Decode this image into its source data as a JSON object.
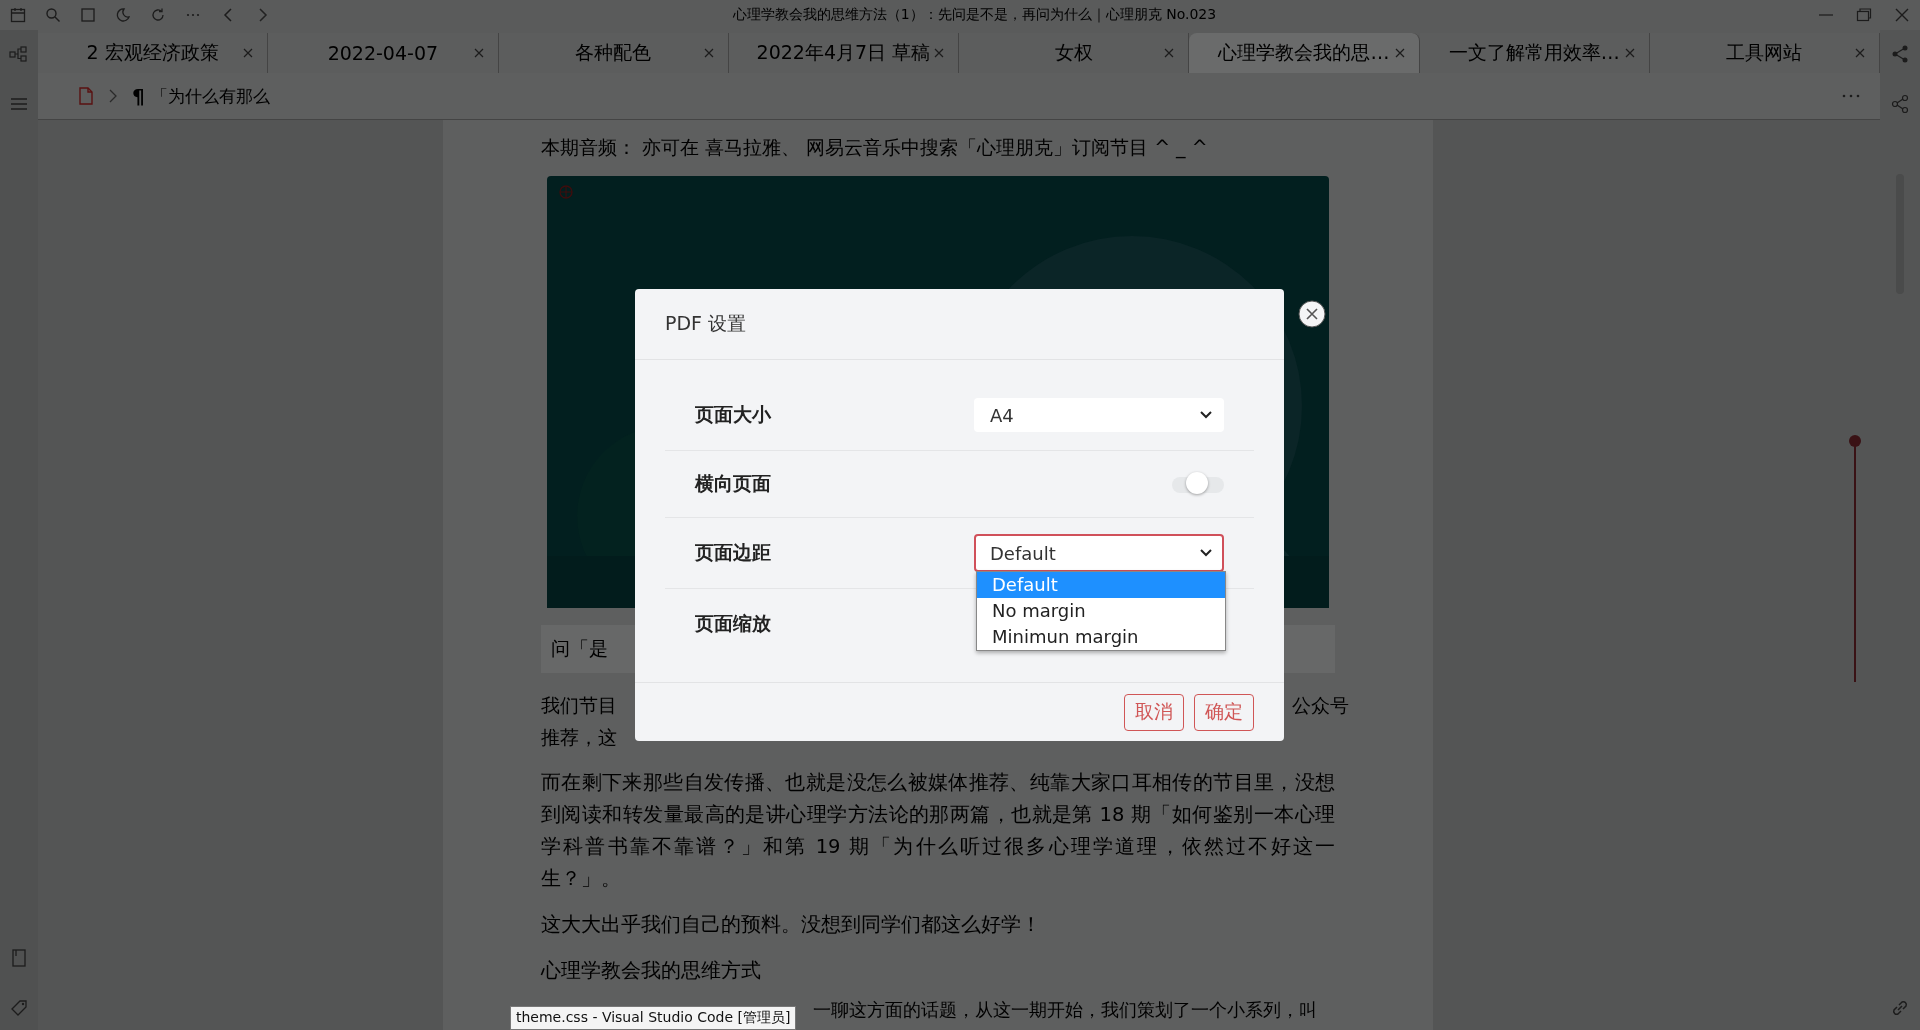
{
  "window": {
    "title": "心理学教会我的思维方法（1）：先问是不是，再问为什么｜心理朋克 No.023"
  },
  "tabs": [
    {
      "label": "2 宏观经济政策",
      "selected": false
    },
    {
      "label": "2022-04-07",
      "selected": false
    },
    {
      "label": "各种配色",
      "selected": false
    },
    {
      "label": "2022年4月7日 草稿",
      "selected": false
    },
    {
      "label": "女权",
      "selected": false
    },
    {
      "label": "心理学教会我的思…",
      "selected": true
    },
    {
      "label": "一文了解常用效率…",
      "selected": false
    },
    {
      "label": "工具网站",
      "selected": false
    }
  ],
  "breadcrumb": {
    "mark": "¶",
    "heading": "「为什么有那么"
  },
  "article": {
    "audio_line": "本期音频： 亦可在 喜马拉雅、 网易云音乐中搜索「心理朋克」订阅节目 ^ _ ^",
    "picture": {
      "kind": "picture"
    },
    "quote": "问「是",
    "p1_left": "我们节目",
    "p1_right": "公众号",
    "p1_line2": "推荐，这",
    "paragraphs": [
      "而在剩下来那些自发传播、也就是没怎么被媒体推荐、纯靠大家口耳相传的节目里，没想到阅读和转发量最高的是讲心理学方法论的那两篇，也就是第 18 期「如何鉴别一本心理学科普书靠不靠谱？」和第 19 期「为什么听过很多心理学道理，依然过不好这一生？」。",
      "这大大出乎我们自己的预料。没想到同学们都这么好学！",
      "心理学教会我的思维方式"
    ],
    "last_line": "一聊这方面的话题，从这一期开始，我们策划了一个小系列，叫"
  },
  "tooltip": "theme.css - Visual Studio Code [管理员]",
  "dialog": {
    "title": "PDF 设置",
    "rows": [
      {
        "kind": "select",
        "label": "页面大小",
        "value": "A4",
        "focused": false
      },
      {
        "kind": "toggle",
        "label": "横向页面",
        "on": false
      },
      {
        "kind": "select",
        "label": "页面边距",
        "value": "Default",
        "focused": true,
        "options": [
          {
            "label": "Default",
            "selected": true
          },
          {
            "label": "No margin",
            "selected": false
          },
          {
            "label": "Minimun margin",
            "selected": false
          }
        ]
      },
      {
        "kind": "covered",
        "label": "页面缩放"
      }
    ],
    "buttons": [
      "取消",
      "确定"
    ]
  }
}
